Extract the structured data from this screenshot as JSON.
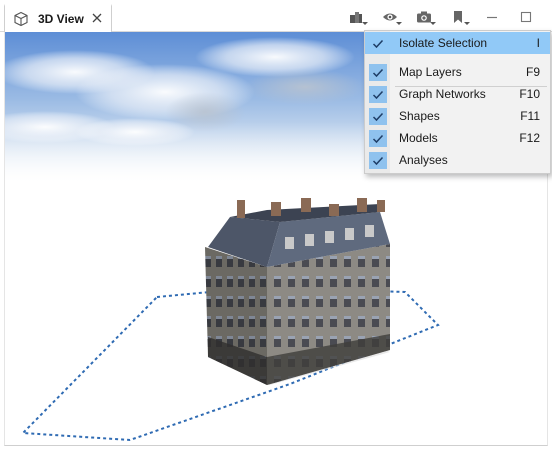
{
  "tab": {
    "title": "3D View",
    "icon": "cube-icon",
    "close_icon": "close-icon"
  },
  "toolbar": {
    "buttons": [
      {
        "icon": "layers-icon"
      },
      {
        "icon": "eye-icon"
      },
      {
        "icon": "camera-icon"
      },
      {
        "icon": "bookmark-icon"
      },
      {
        "icon": "minimize-icon"
      },
      {
        "icon": "maximize-icon"
      }
    ]
  },
  "menu": {
    "items": [
      {
        "label": "Isolate Selection",
        "accel": "I",
        "checked": true,
        "highlighted": true
      },
      {
        "label": "Map Layers",
        "accel": "F9",
        "checked": true
      },
      {
        "label": "Graph Networks",
        "accel": "F10",
        "checked": true
      },
      {
        "label": "Shapes",
        "accel": "F11",
        "checked": true
      },
      {
        "label": "Models",
        "accel": "F12",
        "checked": true
      },
      {
        "label": "Analyses",
        "accel": "",
        "checked": true
      }
    ]
  },
  "colors": {
    "menu_highlight": "#91c9f7",
    "check_bg": "#8fc2ee",
    "polygon": "#2f6bb3",
    "sky_top": "#5d8ed6"
  }
}
